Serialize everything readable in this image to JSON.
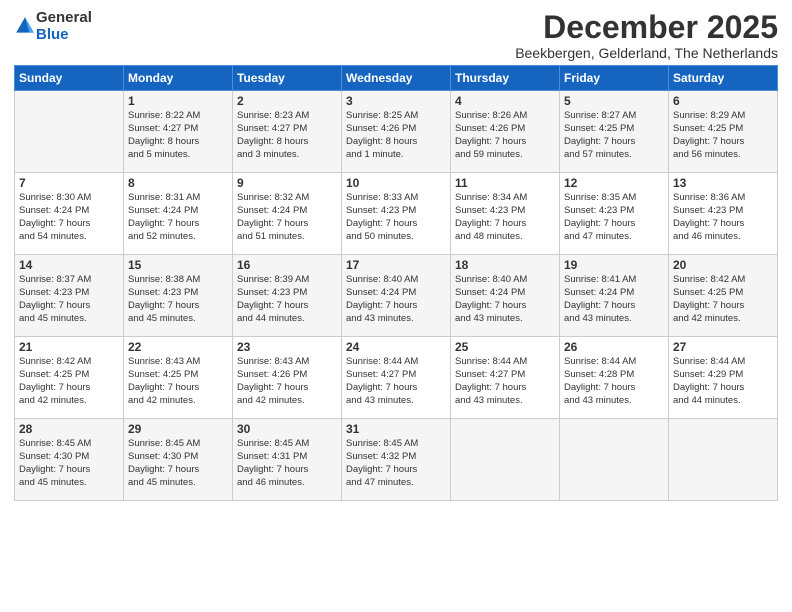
{
  "logo": {
    "general": "General",
    "blue": "Blue"
  },
  "title": "December 2025",
  "subtitle": "Beekbergen, Gelderland, The Netherlands",
  "days_of_week": [
    "Sunday",
    "Monday",
    "Tuesday",
    "Wednesday",
    "Thursday",
    "Friday",
    "Saturday"
  ],
  "weeks": [
    [
      {
        "day": "",
        "info": ""
      },
      {
        "day": "1",
        "info": "Sunrise: 8:22 AM\nSunset: 4:27 PM\nDaylight: 8 hours\nand 5 minutes."
      },
      {
        "day": "2",
        "info": "Sunrise: 8:23 AM\nSunset: 4:27 PM\nDaylight: 8 hours\nand 3 minutes."
      },
      {
        "day": "3",
        "info": "Sunrise: 8:25 AM\nSunset: 4:26 PM\nDaylight: 8 hours\nand 1 minute."
      },
      {
        "day": "4",
        "info": "Sunrise: 8:26 AM\nSunset: 4:26 PM\nDaylight: 7 hours\nand 59 minutes."
      },
      {
        "day": "5",
        "info": "Sunrise: 8:27 AM\nSunset: 4:25 PM\nDaylight: 7 hours\nand 57 minutes."
      },
      {
        "day": "6",
        "info": "Sunrise: 8:29 AM\nSunset: 4:25 PM\nDaylight: 7 hours\nand 56 minutes."
      }
    ],
    [
      {
        "day": "7",
        "info": "Sunrise: 8:30 AM\nSunset: 4:24 PM\nDaylight: 7 hours\nand 54 minutes."
      },
      {
        "day": "8",
        "info": "Sunrise: 8:31 AM\nSunset: 4:24 PM\nDaylight: 7 hours\nand 52 minutes."
      },
      {
        "day": "9",
        "info": "Sunrise: 8:32 AM\nSunset: 4:24 PM\nDaylight: 7 hours\nand 51 minutes."
      },
      {
        "day": "10",
        "info": "Sunrise: 8:33 AM\nSunset: 4:23 PM\nDaylight: 7 hours\nand 50 minutes."
      },
      {
        "day": "11",
        "info": "Sunrise: 8:34 AM\nSunset: 4:23 PM\nDaylight: 7 hours\nand 48 minutes."
      },
      {
        "day": "12",
        "info": "Sunrise: 8:35 AM\nSunset: 4:23 PM\nDaylight: 7 hours\nand 47 minutes."
      },
      {
        "day": "13",
        "info": "Sunrise: 8:36 AM\nSunset: 4:23 PM\nDaylight: 7 hours\nand 46 minutes."
      }
    ],
    [
      {
        "day": "14",
        "info": "Sunrise: 8:37 AM\nSunset: 4:23 PM\nDaylight: 7 hours\nand 45 minutes."
      },
      {
        "day": "15",
        "info": "Sunrise: 8:38 AM\nSunset: 4:23 PM\nDaylight: 7 hours\nand 45 minutes."
      },
      {
        "day": "16",
        "info": "Sunrise: 8:39 AM\nSunset: 4:23 PM\nDaylight: 7 hours\nand 44 minutes."
      },
      {
        "day": "17",
        "info": "Sunrise: 8:40 AM\nSunset: 4:24 PM\nDaylight: 7 hours\nand 43 minutes."
      },
      {
        "day": "18",
        "info": "Sunrise: 8:40 AM\nSunset: 4:24 PM\nDaylight: 7 hours\nand 43 minutes."
      },
      {
        "day": "19",
        "info": "Sunrise: 8:41 AM\nSunset: 4:24 PM\nDaylight: 7 hours\nand 43 minutes."
      },
      {
        "day": "20",
        "info": "Sunrise: 8:42 AM\nSunset: 4:25 PM\nDaylight: 7 hours\nand 42 minutes."
      }
    ],
    [
      {
        "day": "21",
        "info": "Sunrise: 8:42 AM\nSunset: 4:25 PM\nDaylight: 7 hours\nand 42 minutes."
      },
      {
        "day": "22",
        "info": "Sunrise: 8:43 AM\nSunset: 4:25 PM\nDaylight: 7 hours\nand 42 minutes."
      },
      {
        "day": "23",
        "info": "Sunrise: 8:43 AM\nSunset: 4:26 PM\nDaylight: 7 hours\nand 42 minutes."
      },
      {
        "day": "24",
        "info": "Sunrise: 8:44 AM\nSunset: 4:27 PM\nDaylight: 7 hours\nand 43 minutes."
      },
      {
        "day": "25",
        "info": "Sunrise: 8:44 AM\nSunset: 4:27 PM\nDaylight: 7 hours\nand 43 minutes."
      },
      {
        "day": "26",
        "info": "Sunrise: 8:44 AM\nSunset: 4:28 PM\nDaylight: 7 hours\nand 43 minutes."
      },
      {
        "day": "27",
        "info": "Sunrise: 8:44 AM\nSunset: 4:29 PM\nDaylight: 7 hours\nand 44 minutes."
      }
    ],
    [
      {
        "day": "28",
        "info": "Sunrise: 8:45 AM\nSunset: 4:30 PM\nDaylight: 7 hours\nand 45 minutes."
      },
      {
        "day": "29",
        "info": "Sunrise: 8:45 AM\nSunset: 4:30 PM\nDaylight: 7 hours\nand 45 minutes."
      },
      {
        "day": "30",
        "info": "Sunrise: 8:45 AM\nSunset: 4:31 PM\nDaylight: 7 hours\nand 46 minutes."
      },
      {
        "day": "31",
        "info": "Sunrise: 8:45 AM\nSunset: 4:32 PM\nDaylight: 7 hours\nand 47 minutes."
      },
      {
        "day": "",
        "info": ""
      },
      {
        "day": "",
        "info": ""
      },
      {
        "day": "",
        "info": ""
      }
    ]
  ]
}
